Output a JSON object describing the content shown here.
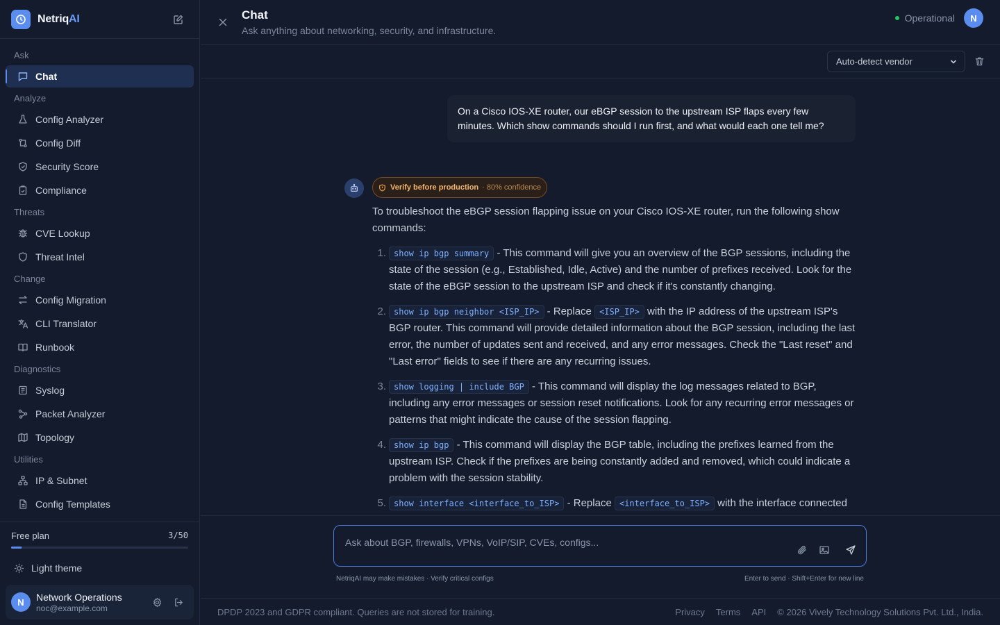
{
  "brand": {
    "name_prefix": "Netriq",
    "name_suffix": "AI"
  },
  "sidebar": {
    "sections": [
      {
        "title": "Ask",
        "items": [
          {
            "label": "Chat",
            "icon": "chat-bubble-icon",
            "active": true
          }
        ]
      },
      {
        "title": "Analyze",
        "items": [
          {
            "label": "Config Analyzer",
            "icon": "flask-icon"
          },
          {
            "label": "Config Diff",
            "icon": "diff-icon"
          },
          {
            "label": "Security Score",
            "icon": "shield-check-icon"
          },
          {
            "label": "Compliance",
            "icon": "clipboard-check-icon"
          }
        ]
      },
      {
        "title": "Threats",
        "items": [
          {
            "label": "CVE Lookup",
            "icon": "bug-icon"
          },
          {
            "label": "Threat Intel",
            "icon": "shield-icon"
          }
        ]
      },
      {
        "title": "Change",
        "items": [
          {
            "label": "Config Migration",
            "icon": "arrows-swap-icon"
          },
          {
            "label": "CLI Translator",
            "icon": "translate-icon"
          },
          {
            "label": "Runbook",
            "icon": "book-icon"
          }
        ]
      },
      {
        "title": "Diagnostics",
        "items": [
          {
            "label": "Syslog",
            "icon": "log-list-icon"
          },
          {
            "label": "Packet Analyzer",
            "icon": "packet-icon"
          },
          {
            "label": "Topology",
            "icon": "map-icon"
          }
        ]
      },
      {
        "title": "Utilities",
        "items": [
          {
            "label": "IP & Subnet",
            "icon": "network-icon"
          },
          {
            "label": "Config Templates",
            "icon": "file-template-icon"
          }
        ]
      }
    ],
    "plan": {
      "label": "Free plan",
      "usage": "3/50",
      "used": 3,
      "limit": 50
    },
    "theme_toggle": "Light theme",
    "user": {
      "initial": "N",
      "name": "Network Operations",
      "email": "noc@example.com"
    }
  },
  "header": {
    "title": "Chat",
    "subtitle": "Ask anything about networking, security, and infrastructure.",
    "status": "Operational",
    "avatar_initial": "N"
  },
  "toolbar": {
    "vendor_select": "Auto-detect vendor"
  },
  "conversation": {
    "user_message": "On a Cisco IOS-XE router, our eBGP session to the upstream ISP flaps every few minutes. Which show commands should I run first, and what would each one tell me?",
    "assistant": {
      "badge_label": "Verify before production",
      "badge_confidence": "· 80% confidence",
      "intro": "To troubleshoot the eBGP session flapping issue on your Cisco IOS-XE router, run the following show commands:",
      "steps": [
        {
          "num": "1.",
          "parts": [
            {
              "type": "code",
              "text": "show ip bgp summary"
            },
            {
              "type": "text",
              "text": " - This command will give you an overview of the BGP sessions, including the state of the session (e.g., Established, Idle, Active) and the number of prefixes received. Look for the state of the eBGP session to the upstream ISP and check if it's constantly changing."
            }
          ]
        },
        {
          "num": "2.",
          "parts": [
            {
              "type": "code",
              "text": "show ip bgp neighbor <ISP_IP>"
            },
            {
              "type": "text",
              "text": " - Replace "
            },
            {
              "type": "code",
              "text": "<ISP_IP>"
            },
            {
              "type": "text",
              "text": " with the IP address of the upstream ISP's BGP router. This command will provide detailed information about the BGP session, including the last error, the number of updates sent and received, and any error messages. Check the \"Last reset\" and \"Last error\" fields to see if there are any recurring issues."
            }
          ]
        },
        {
          "num": "3.",
          "parts": [
            {
              "type": "code",
              "text": "show logging | include BGP"
            },
            {
              "type": "text",
              "text": " - This command will display the log messages related to BGP, including any error messages or session reset notifications. Look for any recurring error messages or patterns that might indicate the cause of the session flapping."
            }
          ]
        },
        {
          "num": "4.",
          "parts": [
            {
              "type": "code",
              "text": "show ip bgp"
            },
            {
              "type": "text",
              "text": " - This command will display the BGP table, including the prefixes learned from the upstream ISP. Check if the prefixes are being constantly added and removed, which could indicate a problem with the session stability."
            }
          ]
        },
        {
          "num": "5.",
          "parts": [
            {
              "type": "code",
              "text": "show interface <interface_to_ISP>"
            },
            {
              "type": "text",
              "text": " - Replace "
            },
            {
              "type": "code",
              "text": "<interface_to_ISP>"
            },
            {
              "type": "text",
              "text": " with the interface connected to"
            }
          ]
        }
      ]
    }
  },
  "composer": {
    "placeholder": "Ask about BGP, firewalls, VPNs, VoIP/SIP, CVEs, configs...",
    "disclaimer": "NetriqAI may make mistakes · Verify critical configs",
    "shortcut_hint": "Enter to send · Shift+Enter for new line"
  },
  "footer": {
    "compliance": "DPDP 2023 and GDPR compliant. Queries are not stored for training.",
    "links": [
      "Privacy",
      "Terms",
      "API"
    ],
    "copyright": "© 2026 Vively Technology Solutions Pvt. Ltd., India."
  },
  "colors": {
    "accent": "#5b8def",
    "status_ok": "#22c55e",
    "warning": "#f0a04b",
    "code": "#7fb0ff"
  }
}
